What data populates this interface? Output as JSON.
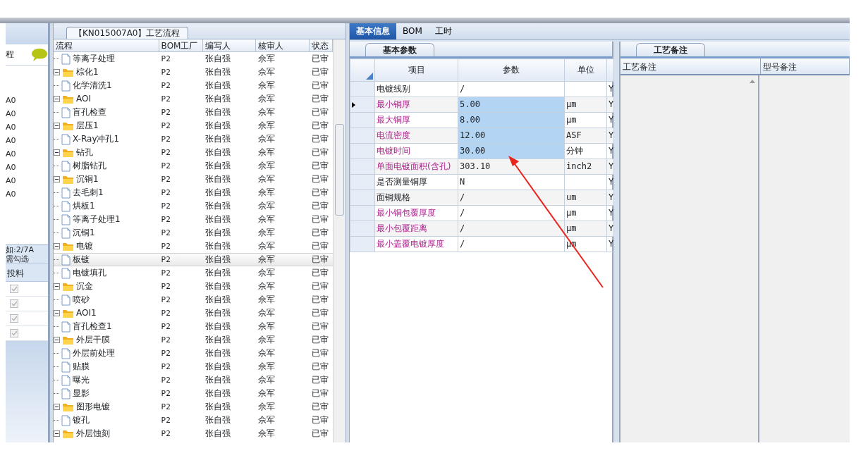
{
  "title_tab": "【KN015007A0】工艺流程",
  "left_panel": {
    "header_text": "程",
    "codes": [
      "A0",
      "A0",
      "A0",
      "A0",
      "A0",
      "A0",
      "A0",
      "A0"
    ],
    "hint_lines": [
      "如:2/7A",
      "需勾选"
    ],
    "column": "投料",
    "checkboxes": [
      {
        "checked": true,
        "disabled": true
      },
      {
        "checked": true,
        "disabled": true
      },
      {
        "checked": true,
        "disabled": true
      },
      {
        "checked": true,
        "disabled": true
      }
    ]
  },
  "flow_table": {
    "columns": [
      "流程",
      "BOM工厂",
      "编写人",
      "核审人",
      "状态"
    ],
    "tree": [
      {
        "kind": "file",
        "name": "等离子处理",
        "bom": "P2",
        "writer": "张自强",
        "reviewer": "佘军",
        "status": "已审",
        "selected": false
      },
      {
        "kind": "folder",
        "name": "棕化1",
        "bom": "P2",
        "writer": "张自强",
        "reviewer": "佘军",
        "status": "已审",
        "selected": false,
        "expanded": true,
        "children": [
          {
            "kind": "file",
            "name": "化学清洗1",
            "bom": "P2",
            "writer": "张自强",
            "reviewer": "佘军",
            "status": "已审",
            "selected": false
          }
        ]
      },
      {
        "kind": "folder",
        "name": "AOI",
        "bom": "P2",
        "writer": "张自强",
        "reviewer": "佘军",
        "status": "已审",
        "selected": false,
        "expanded": true,
        "children": [
          {
            "kind": "file",
            "name": "盲孔检查",
            "bom": "P2",
            "writer": "张自强",
            "reviewer": "佘军",
            "status": "已审",
            "selected": false
          }
        ]
      },
      {
        "kind": "folder",
        "name": "层压1",
        "bom": "P2",
        "writer": "张自强",
        "reviewer": "佘军",
        "status": "已审",
        "selected": false,
        "expanded": true,
        "children": [
          {
            "kind": "file",
            "name": "X-Ray冲孔1",
            "bom": "P2",
            "writer": "张自强",
            "reviewer": "佘军",
            "status": "已审",
            "selected": false
          }
        ]
      },
      {
        "kind": "folder",
        "name": "钻孔",
        "bom": "P2",
        "writer": "张自强",
        "reviewer": "佘军",
        "status": "已审",
        "selected": false,
        "expanded": true,
        "children": [
          {
            "kind": "file",
            "name": "树脂钻孔",
            "bom": "P2",
            "writer": "张自强",
            "reviewer": "佘军",
            "status": "已审",
            "selected": false
          }
        ]
      },
      {
        "kind": "folder",
        "name": "沉铜1",
        "bom": "P2",
        "writer": "张自强",
        "reviewer": "佘军",
        "status": "已审",
        "selected": false,
        "expanded": true,
        "children": [
          {
            "kind": "file",
            "name": "去毛刺1",
            "bom": "P2",
            "writer": "张自强",
            "reviewer": "佘军",
            "status": "已审",
            "selected": false
          },
          {
            "kind": "file",
            "name": "烘板1",
            "bom": "P2",
            "writer": "张自强",
            "reviewer": "佘军",
            "status": "已审",
            "selected": false
          },
          {
            "kind": "file",
            "name": "等离子处理1",
            "bom": "P2",
            "writer": "张自强",
            "reviewer": "佘军",
            "status": "已审",
            "selected": false
          },
          {
            "kind": "file",
            "name": "沉铜1",
            "bom": "P2",
            "writer": "张自强",
            "reviewer": "佘军",
            "status": "已审",
            "selected": false
          }
        ]
      },
      {
        "kind": "folder",
        "name": "电镀",
        "bom": "P2",
        "writer": "张自强",
        "reviewer": "佘军",
        "status": "已审",
        "selected": false,
        "expanded": true,
        "children": [
          {
            "kind": "file",
            "name": "板镀",
            "bom": "P2",
            "writer": "张自强",
            "reviewer": "佘军",
            "status": "已审",
            "selected": true
          },
          {
            "kind": "file",
            "name": "电镀填孔",
            "bom": "P2",
            "writer": "张自强",
            "reviewer": "佘军",
            "status": "已审",
            "selected": false
          }
        ]
      },
      {
        "kind": "folder",
        "name": "沉金",
        "bom": "P2",
        "writer": "张自强",
        "reviewer": "佘军",
        "status": "已审",
        "selected": false,
        "expanded": true,
        "children": [
          {
            "kind": "file",
            "name": "喷砂",
            "bom": "P2",
            "writer": "张自强",
            "reviewer": "佘军",
            "status": "已审",
            "selected": false
          }
        ]
      },
      {
        "kind": "folder",
        "name": "AOI1",
        "bom": "P2",
        "writer": "张自强",
        "reviewer": "佘军",
        "status": "已审",
        "selected": false,
        "expanded": true,
        "children": [
          {
            "kind": "file",
            "name": "盲孔检查1",
            "bom": "P2",
            "writer": "张自强",
            "reviewer": "佘军",
            "status": "已审",
            "selected": false
          }
        ]
      },
      {
        "kind": "folder",
        "name": "外层干膜",
        "bom": "P2",
        "writer": "张自强",
        "reviewer": "佘军",
        "status": "已审",
        "selected": false,
        "expanded": true,
        "children": [
          {
            "kind": "file",
            "name": "外层前处理",
            "bom": "P2",
            "writer": "张自强",
            "reviewer": "佘军",
            "status": "已审",
            "selected": false
          },
          {
            "kind": "file",
            "name": "贴膜",
            "bom": "P2",
            "writer": "张自强",
            "reviewer": "佘军",
            "status": "已审",
            "selected": false
          },
          {
            "kind": "file",
            "name": "曝光",
            "bom": "P2",
            "writer": "张自强",
            "reviewer": "佘军",
            "status": "已审",
            "selected": false
          },
          {
            "kind": "file",
            "name": "显影",
            "bom": "P2",
            "writer": "张自强",
            "reviewer": "佘军",
            "status": "已审",
            "selected": false
          }
        ]
      },
      {
        "kind": "folder",
        "name": "图形电镀",
        "bom": "P2",
        "writer": "张自强",
        "reviewer": "佘军",
        "status": "已审",
        "selected": false,
        "expanded": true,
        "children": [
          {
            "kind": "file",
            "name": "镀孔",
            "bom": "P2",
            "writer": "张自强",
            "reviewer": "佘军",
            "status": "已审",
            "selected": false
          }
        ]
      },
      {
        "kind": "folder",
        "name": "外层蚀刻",
        "bom": "P2",
        "writer": "张自强",
        "reviewer": "佘军",
        "status": "已审",
        "selected": false,
        "expanded": true
      }
    ]
  },
  "tabs": [
    {
      "label": "基本信息",
      "selected": true
    },
    {
      "label": "BOM",
      "selected": false
    },
    {
      "label": "工时",
      "selected": false
    }
  ],
  "params": {
    "tab": "基本参数",
    "columns": [
      "项目",
      "参数",
      "单位"
    ],
    "rows": [
      {
        "item": "电镀线别",
        "value": "/",
        "column_4": "Y",
        "required": false,
        "current": false,
        "selected": false
      },
      {
        "item": "最小铜厚",
        "value": "5.00",
        "unit": "μm",
        "column_4": "Y",
        "required": true,
        "current": true,
        "selected": true
      },
      {
        "item": "最大铜厚",
        "value": "8.00",
        "unit": "μm",
        "column_4": "Y",
        "required": true,
        "current": false,
        "selected": true
      },
      {
        "item": "电流密度",
        "value": "12.00",
        "unit": "ASF",
        "column_4": "Y",
        "required": true,
        "current": false,
        "selected": true
      },
      {
        "item": "电镀时间",
        "value": "30.00",
        "unit": "分钟",
        "column_4": "Y",
        "required": true,
        "current": false,
        "selected": true
      },
      {
        "item": "单面电镀面积(含孔)",
        "value": "303.10",
        "unit": "inch2",
        "column_4": "Y",
        "required": true,
        "current": false,
        "selected": false
      },
      {
        "item": "是否测量铜厚",
        "value": "N",
        "column_4": "Y",
        "required": false,
        "current": false,
        "selected": false
      },
      {
        "item": "面铜规格",
        "value": "/",
        "unit": "um",
        "column_4": "Y",
        "required": false,
        "current": false,
        "selected": false
      },
      {
        "item": "最小铜包覆厚度",
        "value": "/",
        "unit": "μm",
        "column_4": "Y",
        "required": true,
        "current": false,
        "selected": false
      },
      {
        "item": "最小包覆距离",
        "value": "/",
        "unit": "μm",
        "column_4": "Y",
        "required": true,
        "current": false,
        "selected": false
      },
      {
        "item": "最小盖覆电镀厚度",
        "value": "/",
        "unit": "μm",
        "column_4": "Y",
        "required": true,
        "current": false,
        "selected": false
      }
    ]
  },
  "notes": {
    "tab": "工艺备注",
    "columns": [
      "工艺备注",
      "型号备注"
    ]
  }
}
